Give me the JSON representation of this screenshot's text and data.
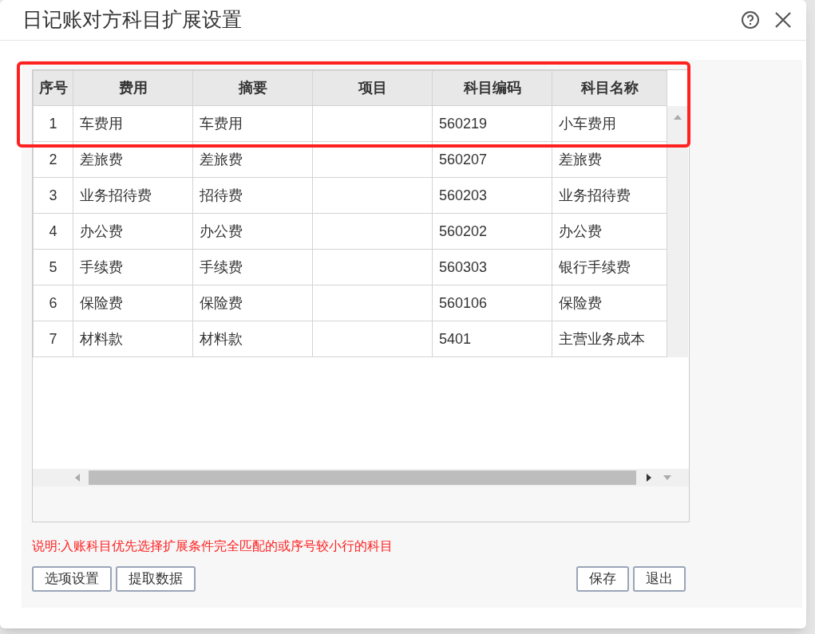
{
  "window": {
    "title": "日记账对方科目扩展设置"
  },
  "table": {
    "columns": [
      "序号",
      "费用",
      "摘要",
      "项目",
      "科目编码",
      "科目名称"
    ],
    "rows": [
      [
        "1",
        "车费用",
        "车费用",
        "",
        "560219",
        "小车费用"
      ],
      [
        "2",
        "差旅费",
        "差旅费",
        "",
        "560207",
        "差旅费"
      ],
      [
        "3",
        "业务招待费",
        "招待费",
        "",
        "560203",
        "业务招待费"
      ],
      [
        "4",
        "办公费",
        "办公费",
        "",
        "560202",
        "办公费"
      ],
      [
        "5",
        "手续费",
        "手续费",
        "",
        "560303",
        "银行手续费"
      ],
      [
        "6",
        "保险费",
        "保险费",
        "",
        "560106",
        "保险费"
      ],
      [
        "7",
        "材料款",
        "材料款",
        "",
        "5401",
        "主营业务成本"
      ]
    ]
  },
  "note": "说明:入账科目优先选择扩展条件完全匹配的或序号较小行的科目",
  "left_buttons": [
    "选项设置",
    "提取数据"
  ],
  "right_buttons": [
    "保存",
    "退出"
  ]
}
